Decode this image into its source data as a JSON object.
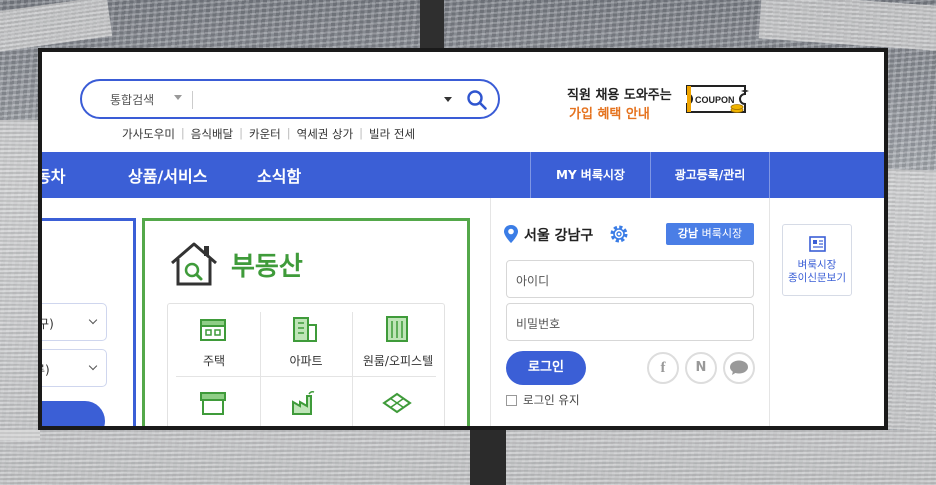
{
  "search": {
    "category": "통합검색",
    "placeholder": ""
  },
  "keywords": [
    "가사도우미",
    "음식배달",
    "카운터",
    "역세권 상가",
    "빌라 전세"
  ],
  "promo": {
    "line1": "직원 채용 도와주는",
    "line2": "가입 혜택 안내",
    "coupon_label": "COUPON"
  },
  "nav": {
    "items": [
      "동차",
      "상품/서비스",
      "소식함"
    ],
    "right": [
      "MY 벼룩시장",
      "광고등록/관리"
    ]
  },
  "left_panel": {
    "select1": "/구)",
    "select2": "류)"
  },
  "real_estate": {
    "title": "부동산",
    "categories": [
      "주택",
      "아파트",
      "원룸/오피스텔",
      "",
      "",
      ""
    ]
  },
  "login": {
    "location": "서울 강남구",
    "market_prefix": "강남",
    "market_suffix": "벼룩시장",
    "id_placeholder": "아이디",
    "pw_placeholder": "비밀번호",
    "login_button": "로그인",
    "keep_login": "로그인 유지",
    "social": [
      "f",
      "N",
      "💬"
    ]
  },
  "paper": {
    "line1": "벼룩시장",
    "line2": "종이신문보기"
  },
  "colors": {
    "brand_blue": "#3b5fd6",
    "green": "#54a84a",
    "orange": "#e5731f"
  }
}
